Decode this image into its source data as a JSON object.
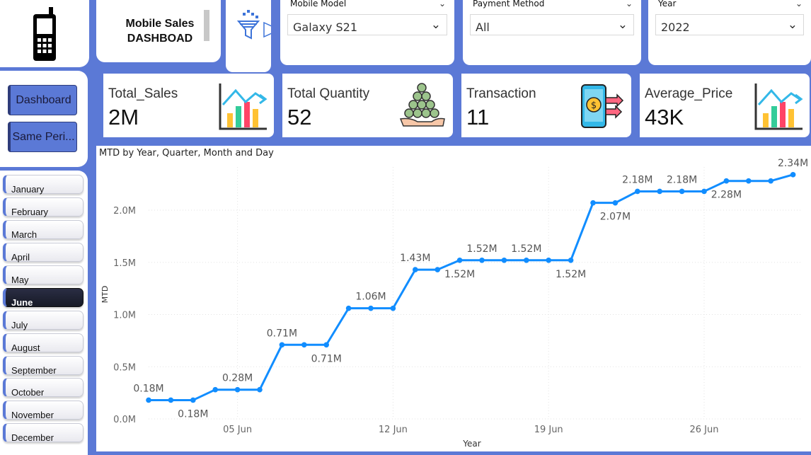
{
  "header": {
    "title_line1": "Mobile Sales",
    "title_line2": "DASHBOAD"
  },
  "slicers": {
    "mobile_model": {
      "label": "Mobile Model",
      "value": "Galaxy S21"
    },
    "payment_method": {
      "label": "Payment Method",
      "value": "All"
    },
    "year": {
      "label": "Year",
      "value": "2022"
    }
  },
  "nav": {
    "dashboard": "Dashboard",
    "same_period": "Same Peri..."
  },
  "months": [
    "January",
    "February",
    "March",
    "April",
    "May",
    "June",
    "July",
    "August",
    "September",
    "October",
    "November",
    "December"
  ],
  "selected_month": "June",
  "kpis": [
    {
      "title": "Total_Sales",
      "value": "2M",
      "icon": "bar-chart-icon"
    },
    {
      "title": "Total Quantity",
      "value": "52",
      "icon": "coins-hand-icon"
    },
    {
      "title": "Transaction",
      "value": "11",
      "icon": "phone-transfer-icon"
    },
    {
      "title": "Average_Price",
      "value": "43K",
      "icon": "bar-chart-icon"
    }
  ],
  "chart": {
    "title": "MTD by Year, Quarter, Month and Day"
  },
  "chart_data": {
    "type": "line",
    "title": "MTD by Year, Quarter, Month and Day",
    "xlabel": "Year",
    "ylabel": "MTD",
    "x_ticks": [
      "05 Jun",
      "12 Jun",
      "19 Jun",
      "26 Jun"
    ],
    "y_ticks": [
      "0.0M",
      "0.5M",
      "1.0M",
      "1.5M",
      "2.0M"
    ],
    "ylim": [
      0,
      2.45
    ],
    "grid": true,
    "series": [
      {
        "color": "#118dff",
        "x": [
          "2022-06-01",
          "2022-06-02",
          "2022-06-03",
          "2022-06-04",
          "2022-06-05",
          "2022-06-06",
          "2022-06-07",
          "2022-06-08",
          "2022-06-09",
          "2022-06-10",
          "2022-06-11",
          "2022-06-12",
          "2022-06-13",
          "2022-06-14",
          "2022-06-15",
          "2022-06-16",
          "2022-06-17",
          "2022-06-18",
          "2022-06-19",
          "2022-06-20",
          "2022-06-21",
          "2022-06-22",
          "2022-06-23",
          "2022-06-24",
          "2022-06-25",
          "2022-06-26",
          "2022-06-27",
          "2022-06-28",
          "2022-06-29",
          "2022-06-30"
        ],
        "values": [
          0.18,
          0.18,
          0.18,
          0.28,
          0.28,
          0.28,
          0.71,
          0.71,
          0.71,
          1.06,
          1.06,
          1.06,
          1.43,
          1.43,
          1.52,
          1.52,
          1.52,
          1.52,
          1.52,
          1.52,
          2.07,
          2.07,
          2.18,
          2.18,
          2.18,
          2.18,
          2.28,
          2.28,
          2.28,
          2.34
        ]
      }
    ],
    "data_labels": [
      {
        "x": "2022-06-01",
        "text": "0.18M",
        "pos": "above"
      },
      {
        "x": "2022-06-03",
        "text": "0.18M",
        "pos": "below"
      },
      {
        "x": "2022-06-05",
        "text": "0.28M",
        "pos": "above"
      },
      {
        "x": "2022-06-07",
        "text": "0.71M",
        "pos": "above"
      },
      {
        "x": "2022-06-09",
        "text": "0.71M",
        "pos": "below"
      },
      {
        "x": "2022-06-11",
        "text": "1.06M",
        "pos": "above"
      },
      {
        "x": "2022-06-13",
        "text": "1.43M",
        "pos": "above"
      },
      {
        "x": "2022-06-15",
        "text": "1.52M",
        "pos": "below"
      },
      {
        "x": "2022-06-16",
        "text": "1.52M",
        "pos": "above"
      },
      {
        "x": "2022-06-18",
        "text": "1.52M",
        "pos": "above"
      },
      {
        "x": "2022-06-20",
        "text": "1.52M",
        "pos": "below"
      },
      {
        "x": "2022-06-22",
        "text": "2.07M",
        "pos": "below"
      },
      {
        "x": "2022-06-23",
        "text": "2.18M",
        "pos": "above"
      },
      {
        "x": "2022-06-25",
        "text": "2.18M",
        "pos": "above"
      },
      {
        "x": "2022-06-27",
        "text": "2.28M",
        "pos": "below"
      },
      {
        "x": "2022-06-30",
        "text": "2.34M",
        "pos": "above"
      }
    ]
  }
}
